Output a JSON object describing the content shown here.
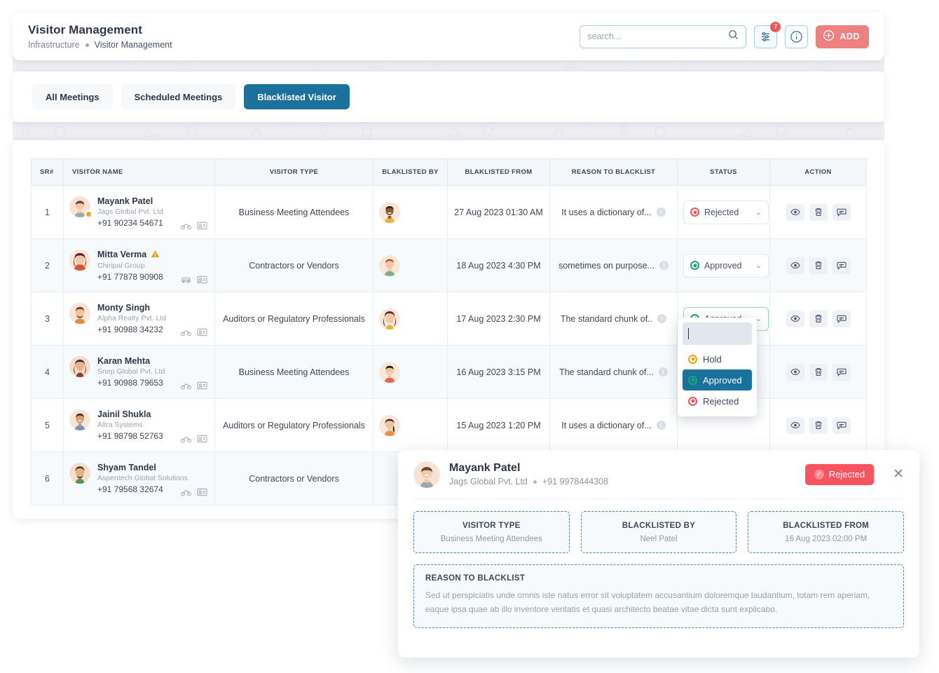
{
  "header": {
    "title": "Visitor Management",
    "breadcrumb": {
      "root": "Infrastructure",
      "current": "Visitor Management"
    },
    "search": {
      "placeholder": "search...",
      "value": ""
    },
    "filter_badge": "7",
    "add_label": "ADD"
  },
  "tabs": [
    {
      "label": "All Meetings",
      "active": false
    },
    {
      "label": "Scheduled Meetings",
      "active": false
    },
    {
      "label": "Blacklisted Visitor",
      "active": true
    }
  ],
  "table": {
    "columns": [
      "SR#",
      "VISITOR NAME",
      "VISITOR TYPE",
      "BLAKLISTED BY",
      "BLAKLISTED FROM",
      "REASON TO BLACKLIST",
      "STATUS",
      "ACTION"
    ],
    "rows": [
      {
        "sr": "1",
        "name": "Mayank Patel",
        "company": "Jags Global Pvt. Ltd",
        "phone": "+91 90234 54671",
        "warning": false,
        "online_dot": true,
        "vehicle": "bike-icon",
        "id_card": "id-card-icon",
        "type": "Business Meeting Attendees",
        "blacklisted_from": "27 Aug 2023 01:30 AM",
        "reason": "It uses a dictionary of...",
        "status": "Rejected",
        "status_color": "#f2545b",
        "dropdown_open": false
      },
      {
        "sr": "2",
        "name": "Mitta Verma",
        "company": "Chiripal Group",
        "phone": "+91 77878 90908",
        "warning": true,
        "online_dot": false,
        "vehicle": "car-icon",
        "id_card": "id-card-icon",
        "type": "Contractors or Vendors",
        "blacklisted_from": "18 Aug 2023 4:30 PM",
        "reason": "sometimes on purpose...",
        "status": "Approved",
        "status_color": "#19a974",
        "dropdown_open": false
      },
      {
        "sr": "3",
        "name": "Monty Singh",
        "company": "Alpha Realty Pvt. Ltd",
        "phone": "+91 90988 34232",
        "warning": false,
        "online_dot": false,
        "vehicle": "bike-icon",
        "id_card": "id-card-icon",
        "type": "Auditors or Regulatory Professionals",
        "blacklisted_from": "17 Aug 2023 2:30 PM",
        "reason": "The standard chunk of..",
        "status": "Approved",
        "status_color": "#19a974",
        "dropdown_open": true
      },
      {
        "sr": "4",
        "name": "Karan Mehta",
        "company": "Snep Global Pvt. Ltd",
        "phone": "+91 90988 79653",
        "warning": false,
        "online_dot": false,
        "vehicle": "bike-icon",
        "id_card": "id-card-icon",
        "type": "Business Meeting Attendees",
        "blacklisted_from": "16 Aug 2023 3:15 PM",
        "reason": "The standard chunk of...",
        "status": "",
        "status_color": "",
        "dropdown_open": false
      },
      {
        "sr": "5",
        "name": "Jainil Shukla",
        "company": "Altra Systems",
        "phone": "+91 98798 52763",
        "warning": false,
        "online_dot": false,
        "vehicle": "bike-icon",
        "id_card": "id-card-icon",
        "type": "Auditors or Regulatory Professionals",
        "blacklisted_from": "15 Aug 2023 1:20 PM",
        "reason": "It uses a dictionary of...",
        "status": "",
        "status_color": "",
        "dropdown_open": false
      },
      {
        "sr": "6",
        "name": "Shyam Tandel",
        "company": "Aspentech Global Solutions",
        "phone": "+91 79568 32674",
        "warning": false,
        "online_dot": false,
        "vehicle": "bike-icon",
        "id_card": "id-card-icon",
        "type": "Contractors or Vendors",
        "blacklisted_from": "",
        "reason": "",
        "status": "",
        "status_color": "",
        "dropdown_open": false
      }
    ]
  },
  "status_dropdown": {
    "search_value": "",
    "options": [
      {
        "label": "Hold",
        "color": "#f0a31a",
        "selected": false
      },
      {
        "label": "Approved",
        "color": "#19a974",
        "selected": true
      },
      {
        "label": "Rejected",
        "color": "#f2545b",
        "selected": false
      }
    ]
  },
  "detail": {
    "name": "Mayank Patel",
    "company": "Jags Global Pvt. Ltd",
    "phone": "+91 9978444308",
    "status_label": "Rejected",
    "status_color": "#f9535f",
    "tiles": [
      {
        "label": "VISITOR TYPE",
        "value": "Business Meeting Attendees"
      },
      {
        "label": "BLACKLISTED BY",
        "value": "Neel Patel"
      },
      {
        "label": "BLACKLISTED FROM",
        "value": "16 Aug 2023 02:00 PM"
      }
    ],
    "reason_title": "REASON TO BLACKLIST",
    "reason_text": "Sed ut perspiciatis unde omnis iste natus error sit voluptatem accusantium doloremque laudantium, totam rem aperiam, eaque ipsa quae ab illo inventore veritatis et quasi architecto beatae vitae dicta sunt explicabo."
  }
}
